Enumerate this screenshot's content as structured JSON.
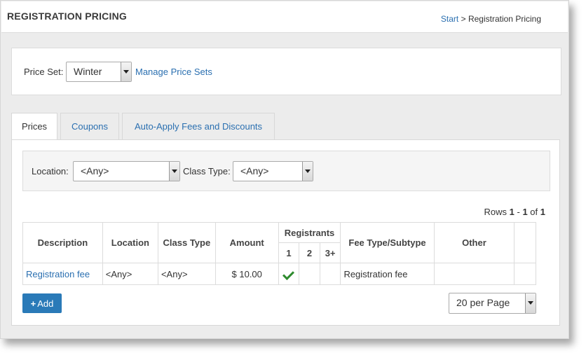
{
  "header": {
    "title": "REGISTRATION PRICING",
    "breadcrumb_start": "Start",
    "breadcrumb_sep": ">",
    "breadcrumb_current": "Registration Pricing"
  },
  "price_set": {
    "label": "Price Set:",
    "value": "Winter",
    "manage_link": "Manage Price Sets"
  },
  "tabs": [
    {
      "label": "Prices",
      "active": true
    },
    {
      "label": "Coupons",
      "active": false
    },
    {
      "label": "Auto-Apply Fees and Discounts",
      "active": false
    }
  ],
  "filters": {
    "location_label": "Location:",
    "location_value": "<Any>",
    "class_type_label": "Class Type:",
    "class_type_value": "<Any>"
  },
  "rows_info": {
    "prefix": "Rows",
    "from": "1",
    "dash": "-",
    "to": "1",
    "of": "of",
    "total": "1"
  },
  "table": {
    "headers": {
      "description": "Description",
      "location": "Location",
      "class_type": "Class Type",
      "amount": "Amount",
      "registrants": "Registrants",
      "reg_1": "1",
      "reg_2": "2",
      "reg_3": "3+",
      "fee_type": "Fee Type/Subtype",
      "other": "Other"
    },
    "rows": [
      {
        "description": "Registration fee",
        "location": "<Any>",
        "class_type": "<Any>",
        "amount": "$ 10.00",
        "fee_type": "Registration fee",
        "other": ""
      }
    ]
  },
  "add_button": {
    "icon": "plus-icon",
    "label": "Add"
  },
  "per_page": {
    "value": "20 per Page"
  },
  "colors": {
    "link": "#2a6fb0",
    "button": "#2a7ab8",
    "check": "#2e8b2e"
  }
}
